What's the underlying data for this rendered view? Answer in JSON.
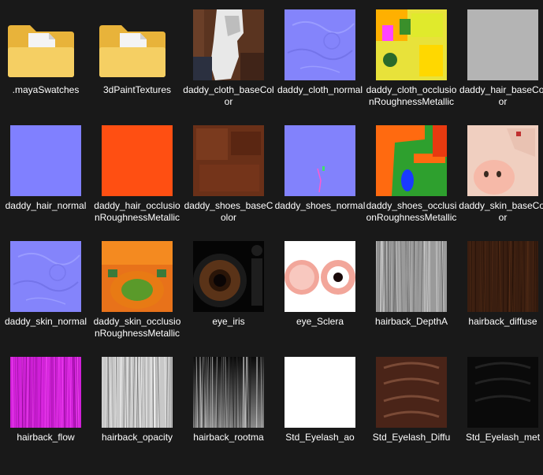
{
  "files": [
    {
      "name": ".mayaSwatches",
      "kind": "folder"
    },
    {
      "name": "3dPaintTextures",
      "kind": "folder"
    },
    {
      "name": "daddy_cloth_baseColor",
      "kind": "texture",
      "thumb": "cloth-base"
    },
    {
      "name": "daddy_cloth_normal",
      "kind": "texture",
      "thumb": "normal-detail"
    },
    {
      "name": "daddy_cloth_occlusionRoughnessMetallic",
      "kind": "texture",
      "thumb": "orm-yellow"
    },
    {
      "name": "daddy_hair_baseColor",
      "kind": "texture",
      "thumb": "solid-grey"
    },
    {
      "name": "daddy_hair_normal",
      "kind": "texture",
      "thumb": "solid-normal"
    },
    {
      "name": "daddy_hair_occlusionRoughnessMetallic",
      "kind": "texture",
      "thumb": "solid-orange"
    },
    {
      "name": "daddy_shoes_baseColor",
      "kind": "texture",
      "thumb": "shoes-base"
    },
    {
      "name": "daddy_shoes_normal",
      "kind": "texture",
      "thumb": "normal-plain"
    },
    {
      "name": "daddy_shoes_occlusionRoughnessMetallic",
      "kind": "texture",
      "thumb": "orm-green"
    },
    {
      "name": "daddy_skin_baseColor",
      "kind": "texture",
      "thumb": "skin-base"
    },
    {
      "name": "daddy_skin_normal",
      "kind": "texture",
      "thumb": "normal-detail"
    },
    {
      "name": "daddy_skin_occlusionRoughnessMetallic",
      "kind": "texture",
      "thumb": "orm-skin"
    },
    {
      "name": "eye_iris",
      "kind": "texture",
      "thumb": "iris"
    },
    {
      "name": "eye_Sclera",
      "kind": "texture",
      "thumb": "sclera"
    },
    {
      "name": "hairback_DepthA",
      "kind": "texture",
      "thumb": "hair-grey"
    },
    {
      "name": "hairback_diffuse",
      "kind": "texture",
      "thumb": "hair-brown"
    },
    {
      "name": "hairback_flow",
      "kind": "texture",
      "thumb": "hair-magenta"
    },
    {
      "name": "hairback_opacity",
      "kind": "texture",
      "thumb": "hair-white"
    },
    {
      "name": "hairback_rootma",
      "kind": "texture",
      "thumb": "hair-dark"
    },
    {
      "name": "Std_Eyelash_ao",
      "kind": "texture",
      "thumb": "solid-white"
    },
    {
      "name": "Std_Eyelash_Diffu",
      "kind": "texture",
      "thumb": "eyelash-brown"
    },
    {
      "name": "Std_Eyelash_met",
      "kind": "texture",
      "thumb": "eyelash-black"
    }
  ],
  "colors": {
    "background": "#191919",
    "folder_back": "#e8b33a",
    "folder_front": "#f5cf63",
    "normal_blue": "#8080ff",
    "orange": "#ff4f12",
    "grey": "#b4b4b4"
  }
}
